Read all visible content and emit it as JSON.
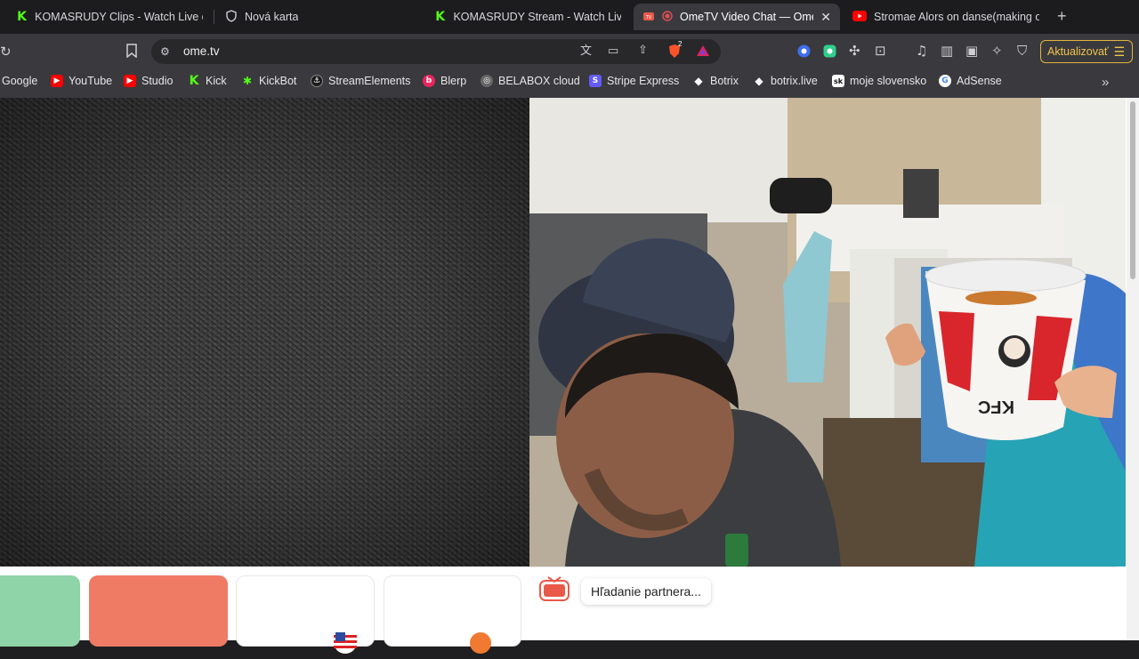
{
  "browser": {
    "tabs": [
      {
        "title": "KOMASRUDY Clips - Watch Live on",
        "icon": "kick-icon"
      },
      {
        "title": "Nová karta",
        "icon": "shield-icon"
      },
      {
        "title": "KOMASRUDY Stream - Watch Live",
        "icon": "kick-icon"
      },
      {
        "title": "OmeTV Video Chat — Omeg",
        "icon": "ometv-icon",
        "active": true
      },
      {
        "title": "Stromae Alors on danse(making of",
        "icon": "youtube-icon"
      }
    ],
    "new_tab_label": "+",
    "close_label": "✕",
    "url": "ome.tv",
    "shields_badge": "2",
    "update_label": "Aktualizovať"
  },
  "bookmarks": [
    {
      "label": "Google",
      "icon": "google-icon"
    },
    {
      "label": "YouTube",
      "icon": "youtube-icon",
      "color": "#ff0000"
    },
    {
      "label": "Studio",
      "icon": "youtube-studio-icon",
      "color": "#ff0000"
    },
    {
      "label": "Kick",
      "icon": "kick-icon",
      "color": "#53fc18"
    },
    {
      "label": "KickBot",
      "icon": "kickbot-icon",
      "color": "#53fc18"
    },
    {
      "label": "StreamElements",
      "icon": "streamelements-icon"
    },
    {
      "label": "Blerp",
      "icon": "blerp-icon",
      "color": "#e8265f"
    },
    {
      "label": "BELABOX cloud",
      "icon": "globe-icon"
    },
    {
      "label": "Stripe Express",
      "icon": "stripe-icon",
      "color": "#635bff"
    },
    {
      "label": "Botrix",
      "icon": "botrix-icon"
    },
    {
      "label": "botrix.live",
      "icon": "botrix-icon"
    },
    {
      "label": "moje slovensko",
      "icon": "sk-icon"
    },
    {
      "label": "AdSense",
      "icon": "adsense-icon"
    }
  ],
  "page": {
    "chat_logo_text": "Ome TV",
    "status_message": "Hľadanie partnera...",
    "kfc_text": "KFC",
    "tiles": [
      {
        "name": "next-button",
        "color": "#8fd3a8"
      },
      {
        "name": "stop-button",
        "color": "#ef7b65"
      },
      {
        "name": "country-button",
        "color": "#ffffff"
      },
      {
        "name": "gender-button",
        "color": "#ffffff"
      }
    ]
  }
}
